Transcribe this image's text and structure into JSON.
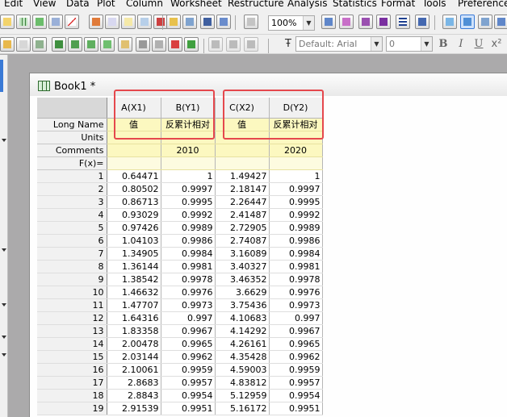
{
  "menu": [
    "Edit",
    "View",
    "Data",
    "Plot",
    "Column",
    "Worksheet",
    "Restructure",
    "Analysis",
    "Statistics",
    "Format",
    "Tools",
    "Preferences"
  ],
  "toolbar": {
    "zoom_value": "100%",
    "font_value": "Default: Arial",
    "font_size_value": "0",
    "bold_label": "B",
    "italic_label": "I",
    "underline_label": "U"
  },
  "workbook": {
    "title": "Book1 *",
    "columns": [
      {
        "header": "A(X1)",
        "long_name": "值",
        "units": "",
        "comments": ""
      },
      {
        "header": "B(Y1)",
        "long_name": "反累计相对",
        "units": "",
        "comments": "2010"
      },
      {
        "header": "C(X2)",
        "long_name": "值",
        "units": "",
        "comments": ""
      },
      {
        "header": "D(Y2)",
        "long_name": "反累计相对",
        "units": "",
        "comments": "2020"
      }
    ],
    "row_labels": {
      "long_name": "Long Name",
      "units": "Units",
      "comments": "Comments",
      "fx": "F(x)="
    },
    "rows": [
      [
        "1",
        "0.64471",
        "1",
        "1.49427",
        "1"
      ],
      [
        "2",
        "0.80502",
        "0.9997",
        "2.18147",
        "0.9997"
      ],
      [
        "3",
        "0.86713",
        "0.9995",
        "2.26447",
        "0.9995"
      ],
      [
        "4",
        "0.93029",
        "0.9992",
        "2.41487",
        "0.9992"
      ],
      [
        "5",
        "0.97426",
        "0.9989",
        "2.72905",
        "0.9989"
      ],
      [
        "6",
        "1.04103",
        "0.9986",
        "2.74087",
        "0.9986"
      ],
      [
        "7",
        "1.34905",
        "0.9984",
        "3.16089",
        "0.9984"
      ],
      [
        "8",
        "1.36144",
        "0.9981",
        "3.40327",
        "0.9981"
      ],
      [
        "9",
        "1.38542",
        "0.9978",
        "3.46352",
        "0.9978"
      ],
      [
        "10",
        "1.46632",
        "0.9976",
        "3.6629",
        "0.9976"
      ],
      [
        "11",
        "1.47707",
        "0.9973",
        "3.75436",
        "0.9973"
      ],
      [
        "12",
        "1.64316",
        "0.997",
        "4.10683",
        "0.997"
      ],
      [
        "13",
        "1.83358",
        "0.9967",
        "4.14292",
        "0.9967"
      ],
      [
        "14",
        "2.00478",
        "0.9965",
        "4.26161",
        "0.9965"
      ],
      [
        "15",
        "2.03144",
        "0.9962",
        "4.35428",
        "0.9962"
      ],
      [
        "16",
        "2.10061",
        "0.9959",
        "4.59003",
        "0.9959"
      ],
      [
        "17",
        "2.8683",
        "0.9957",
        "4.83812",
        "0.9957"
      ],
      [
        "18",
        "2.8843",
        "0.9954",
        "5.12959",
        "0.9954"
      ],
      [
        "19",
        "2.91539",
        "0.9951",
        "5.16172",
        "0.9951"
      ]
    ]
  },
  "colors": {
    "highlight": "#e5484d",
    "meta_fill": "#fcf8c0",
    "header_fill": "#f1f1f1"
  }
}
